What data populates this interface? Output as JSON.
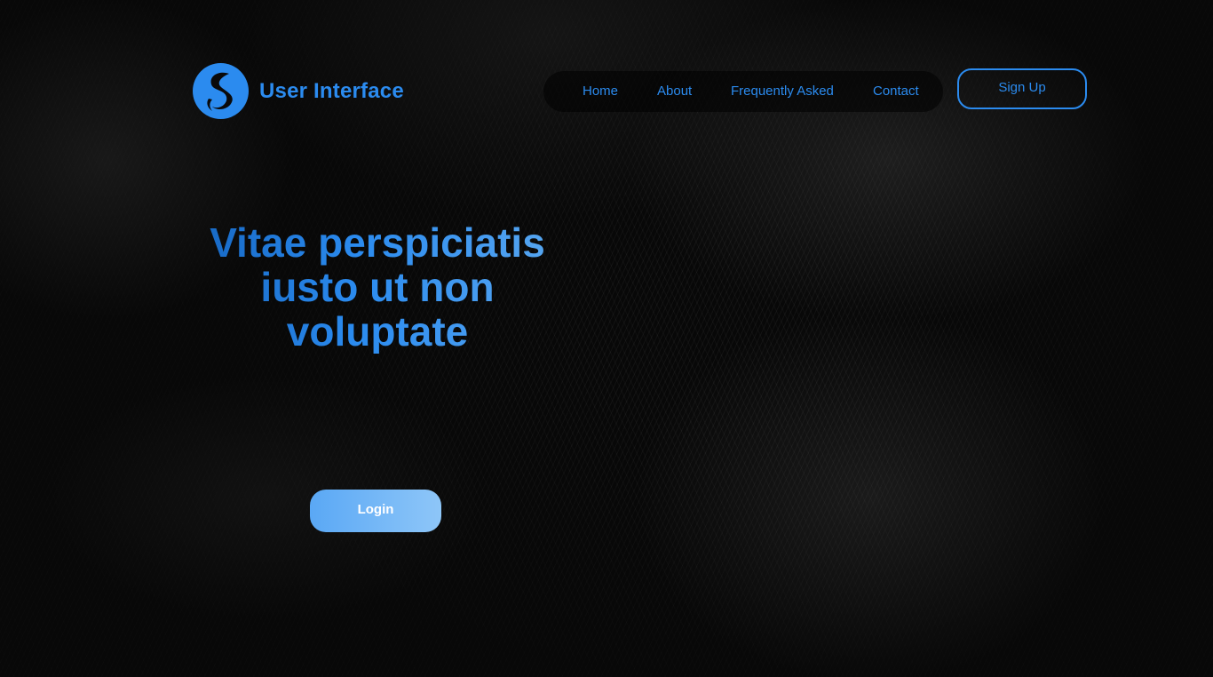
{
  "brand": {
    "name": "User Interface",
    "logo_icon": "globe-s-logo-icon",
    "color": "#2b8bef"
  },
  "nav": {
    "items": [
      {
        "label": "Home"
      },
      {
        "label": "About"
      },
      {
        "label": "Frequently Asked"
      },
      {
        "label": "Contact"
      }
    ],
    "signup_label": "Sign Up"
  },
  "hero": {
    "headline": "Vitae perspiciatis iusto ut non voluptate",
    "login_label": "Login"
  },
  "colors": {
    "background": "#080808",
    "accent": "#2b8bef",
    "login_gradient_start": "#5aa8f5",
    "login_gradient_end": "#8ec6f8"
  }
}
